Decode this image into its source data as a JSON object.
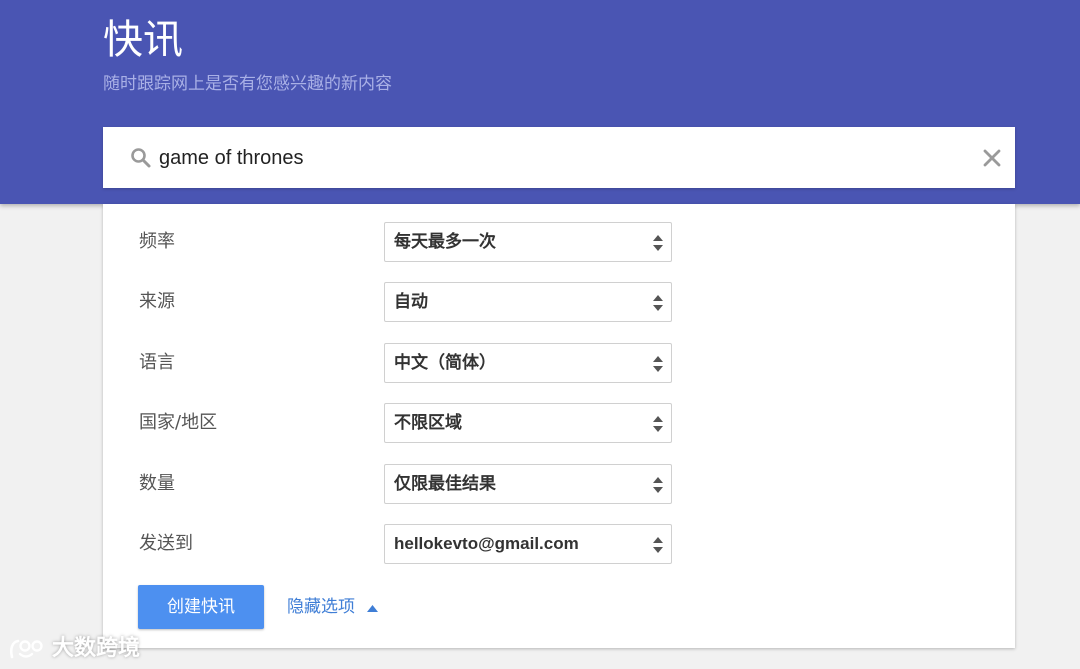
{
  "header": {
    "title": "快讯",
    "subtitle": "随时跟踪网上是否有您感兴趣的新内容",
    "background_color": "#4a55b3"
  },
  "search": {
    "value": "game of thrones",
    "icon": "search-icon",
    "clear_icon": "close-icon"
  },
  "options": [
    {
      "label": "频率",
      "value": "每天最多一次"
    },
    {
      "label": "来源",
      "value": "自动"
    },
    {
      "label": "语言",
      "value": "中文（简体）"
    },
    {
      "label": "国家/地区",
      "value": "不限区域"
    },
    {
      "label": "数量",
      "value": "仅限最佳结果"
    },
    {
      "label": "发送到",
      "value": "hellokevto@gmail.com"
    }
  ],
  "actions": {
    "create_label": "创建快讯",
    "create_color": "#4d90f0",
    "hide_options_label": "隐藏选项",
    "hide_options_icon": "triangle-up-icon"
  },
  "watermark": {
    "text": "大数跨境",
    "icon": "watermark-logo"
  }
}
